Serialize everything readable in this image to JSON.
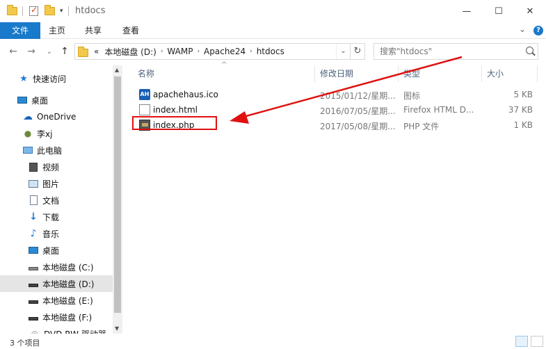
{
  "window": {
    "title": "htdocs",
    "minimize_glyph": "—",
    "maximize_glyph": "☐",
    "close_glyph": "✕"
  },
  "ribbon": {
    "tabs": [
      "文件",
      "主页",
      "共享",
      "查看"
    ],
    "help_glyph": "?",
    "collapse_glyph": "⌄"
  },
  "address": {
    "overflow": "«",
    "crumbs": [
      "本地磁盘 (D:)",
      "WAMP",
      "Apache24",
      "htdocs"
    ],
    "back_glyph": "←",
    "forward_glyph": "→",
    "recent_glyph": "⌄",
    "up_glyph": "↑",
    "refresh_glyph": "↻",
    "dropdown_glyph": "⌄"
  },
  "search": {
    "placeholder": "搜索\"htdocs\""
  },
  "nav": {
    "items": [
      {
        "label": "快速访问",
        "icon": "star-icon"
      },
      {
        "label": "桌面",
        "icon": "desktop-icon"
      },
      {
        "label": "OneDrive",
        "icon": "cloud-icon"
      },
      {
        "label": "李xj",
        "icon": "user-icon"
      },
      {
        "label": "此电脑",
        "icon": "computer-icon"
      },
      {
        "label": "视频",
        "icon": "video-icon"
      },
      {
        "label": "图片",
        "icon": "pictures-icon"
      },
      {
        "label": "文档",
        "icon": "documents-icon"
      },
      {
        "label": "下载",
        "icon": "download-icon"
      },
      {
        "label": "音乐",
        "icon": "music-icon"
      },
      {
        "label": "桌面",
        "icon": "desktop-icon"
      },
      {
        "label": "本地磁盘 (C:)",
        "icon": "drive-c-icon"
      },
      {
        "label": "本地磁盘 (D:)",
        "icon": "drive-icon"
      },
      {
        "label": "本地磁盘 (E:)",
        "icon": "drive-icon"
      },
      {
        "label": "本地磁盘 (F:)",
        "icon": "drive-icon"
      },
      {
        "label": "DVD RW 驱动器",
        "icon": "dvd-icon"
      }
    ],
    "selected_label": "本地磁盘 (D:)"
  },
  "columns": {
    "name": "名称",
    "modified": "修改日期",
    "type": "类型",
    "size": "大小"
  },
  "files": [
    {
      "name": "apachehaus.ico",
      "modified": "2015/01/12/星期...",
      "type": "图标",
      "size": "5 KB",
      "icon": "apachehaus-icon"
    },
    {
      "name": "index.html",
      "modified": "2016/07/05/星期...",
      "type": "Firefox HTML D...",
      "size": "37 KB",
      "icon": "html-file-icon"
    },
    {
      "name": "index.php",
      "modified": "2017/05/08/星期...",
      "type": "PHP 文件",
      "size": "1 KB",
      "icon": "php-file-icon"
    }
  ],
  "status": {
    "count": "3 个项目"
  },
  "colors": {
    "accent": "#1979ca",
    "annotation": "#e01010"
  }
}
